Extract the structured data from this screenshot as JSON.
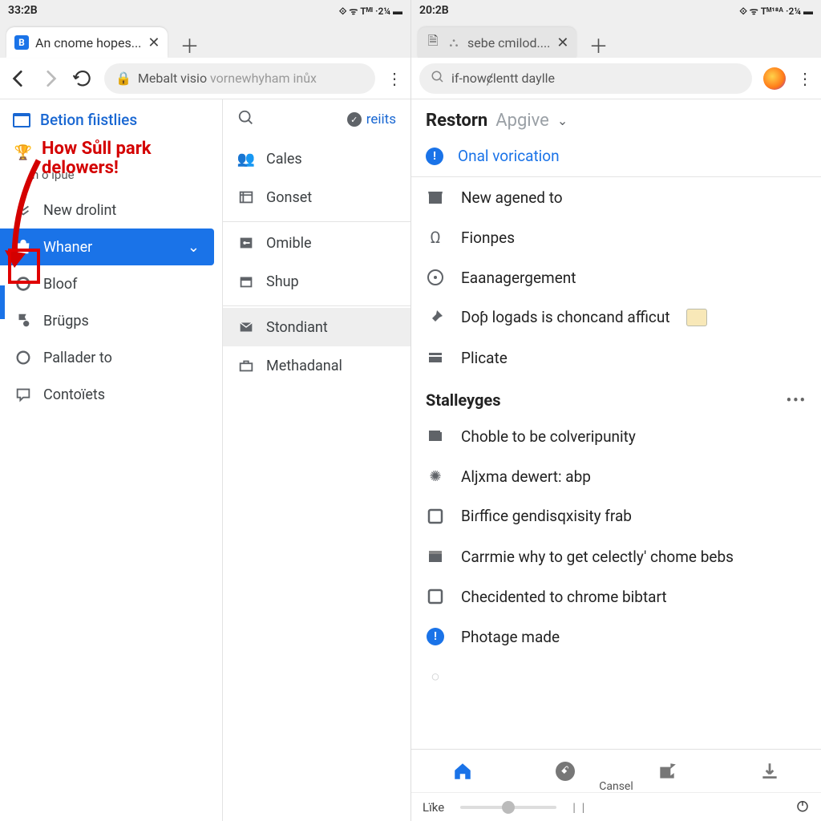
{
  "left": {
    "status": {
      "time": "33:2B",
      "indicators": "⟐ ᯤ Tᴹᴵ ·2¼ ▬"
    },
    "tab": {
      "title": "An cnome hopes..."
    },
    "address": {
      "secure_prefix": "Mebalt visio",
      "dim_suffix": " vornewhyham inůx"
    },
    "sidebar_title": "Betion fiistlies",
    "annotation_line1": "How Sůll park",
    "annotation_line2": "delowers!",
    "items": [
      {
        "label": "h  o ipue",
        "small": true
      },
      {
        "label": "New drolint"
      },
      {
        "label": "Whaner",
        "selected": true
      },
      {
        "label": "Bloof"
      },
      {
        "label": "Brügps"
      },
      {
        "label": "Pallader to"
      },
      {
        "label": "Contoïets"
      }
    ],
    "mid_badge": "reiits",
    "mid_items": [
      {
        "label": "Cales"
      },
      {
        "label": "Gonset"
      },
      {
        "label": "Omible"
      },
      {
        "label": "Shup"
      },
      {
        "label": "Stondiant",
        "selected": true
      },
      {
        "label": "Methadanal"
      }
    ]
  },
  "right": {
    "status": {
      "time": "20:2B",
      "indicators": "⟐ ᯤ Tᴹ¹⁸ᴬ ·2¼ ▬"
    },
    "tab": {
      "title": "sebe cmilod...."
    },
    "search_placeholder": "if-nowȼlentt daylle",
    "header_bold": "Restorn",
    "header_dim": "Apgive",
    "onal": "Onal vorication",
    "group1": [
      "New agened to",
      "Fionpes",
      "Eaanagergement",
      "Doƥ logads is choncand afficut",
      "Plicate"
    ],
    "section2": "Stalleyges",
    "group2": [
      "Choble to be colveripunity",
      "Aljxma dewert: abp",
      "Biɾffice gendisqxisity frab",
      "Carrmie why to get celectly' chome bebs",
      "Checidented to chrome bibtart",
      "Photage made"
    ],
    "bottom_cancel": "Cansel",
    "footer_like": "Lïke"
  }
}
